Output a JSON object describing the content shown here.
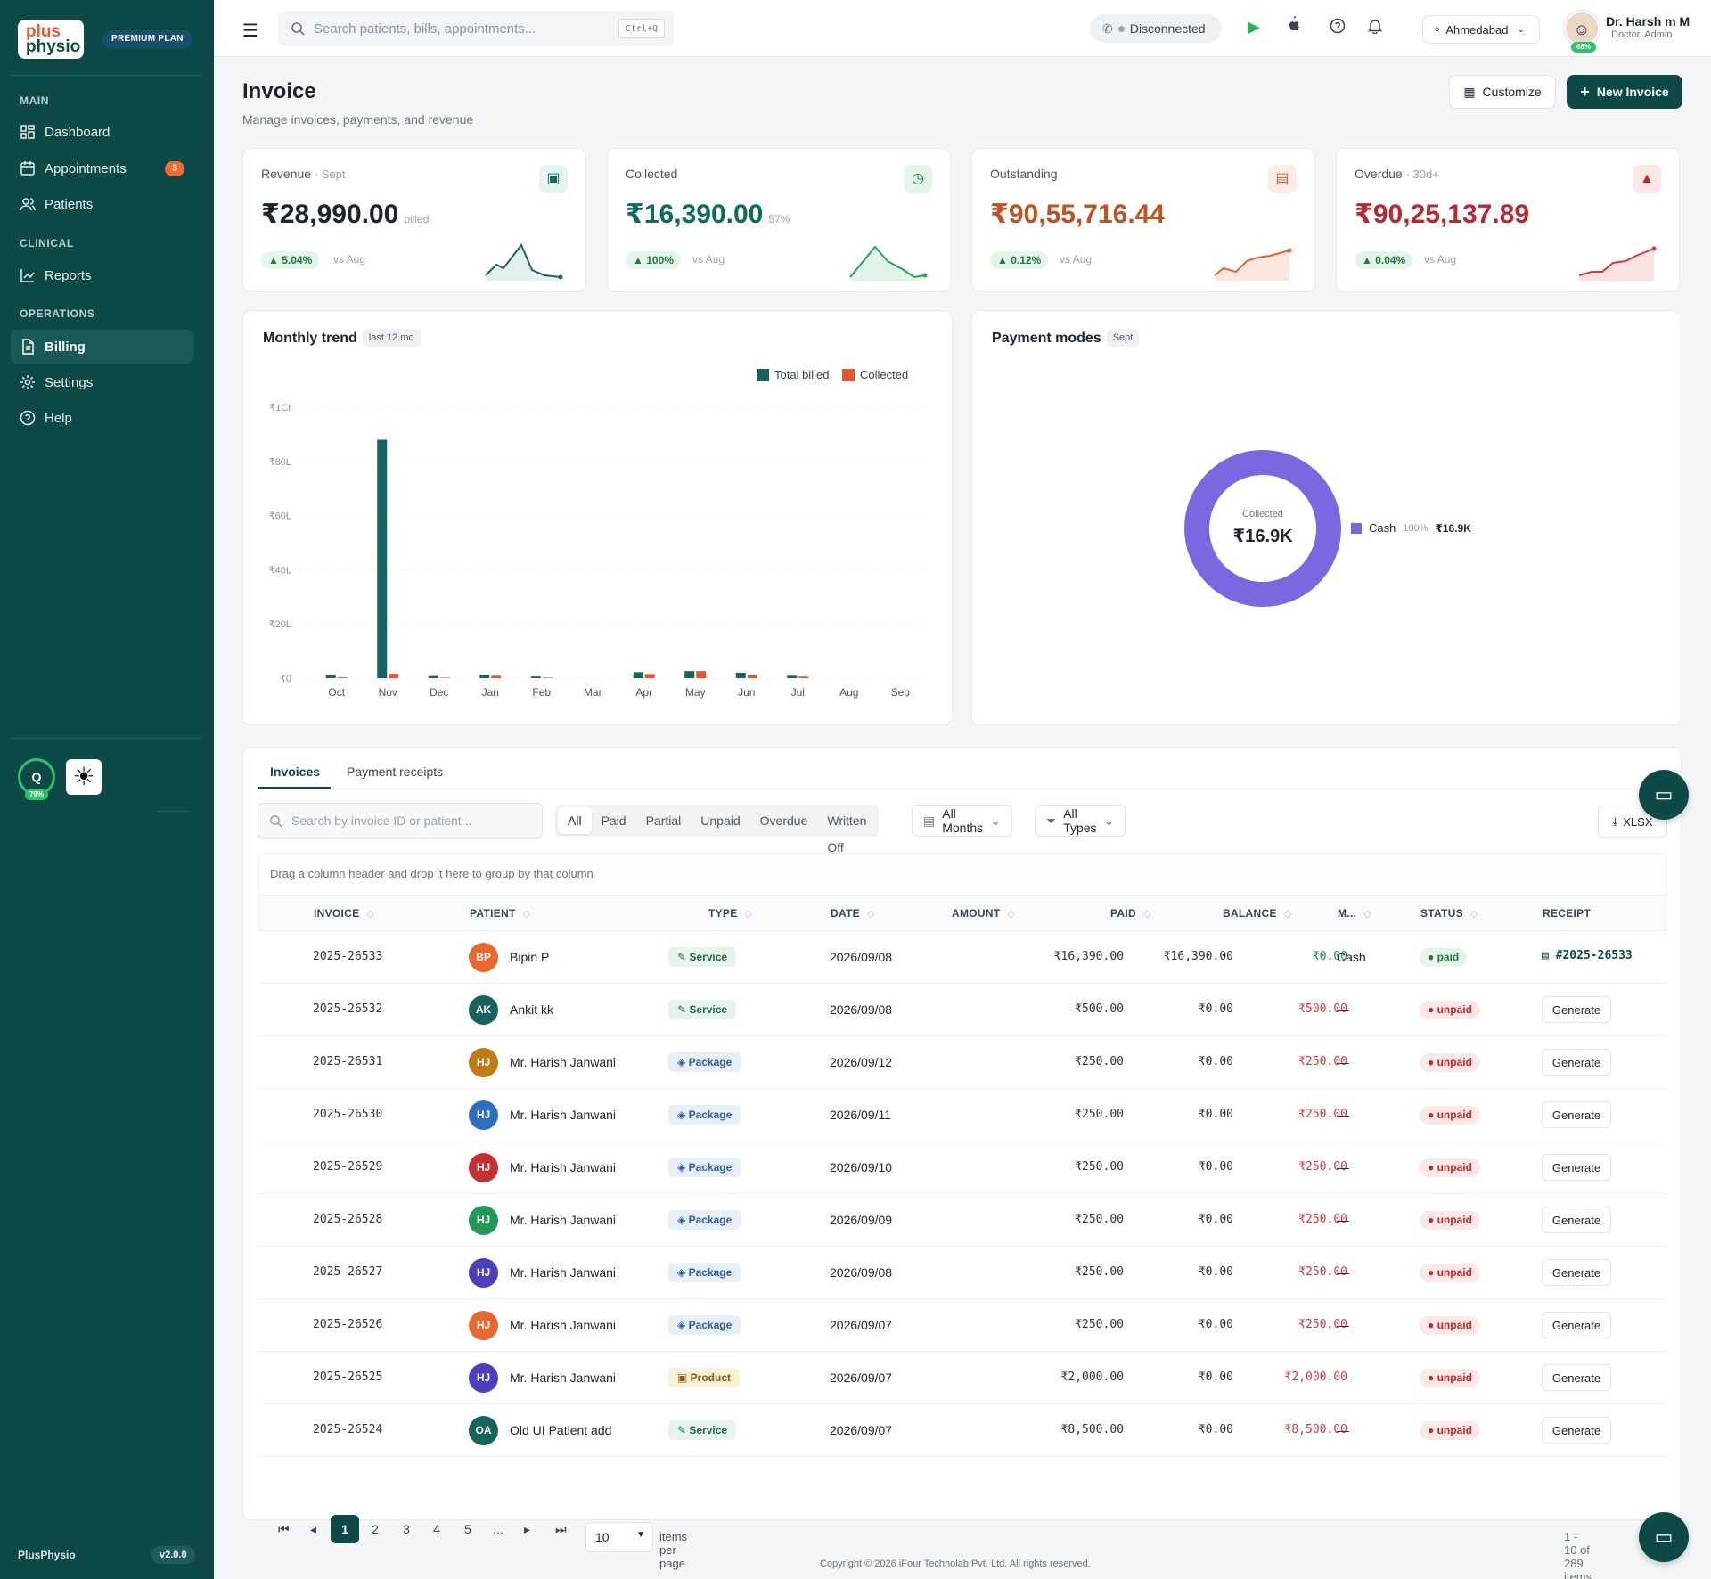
{
  "brand": {
    "logo_line1": "plus",
    "logo_line2": "physio",
    "plan": "PREMIUM PLAN",
    "name": "PlusPhysio",
    "version": "v2.0.0"
  },
  "sidebar": {
    "sections": [
      "MAIN",
      "CLINICAL",
      "OPERATIONS"
    ],
    "items": [
      {
        "label": "Dashboard",
        "icon": "grid-icon"
      },
      {
        "label": "Appointments",
        "icon": "calendar-icon",
        "badge": "3"
      },
      {
        "label": "Patients",
        "icon": "users-icon"
      },
      {
        "label": "Reports",
        "icon": "chart-line-icon"
      },
      {
        "label": "Billing",
        "icon": "file-icon",
        "active": true
      },
      {
        "label": "Settings",
        "icon": "gear-icon"
      },
      {
        "label": "Help",
        "icon": "help-icon"
      }
    ],
    "q_badge": {
      "letter": "Q",
      "percent": "79%"
    }
  },
  "topbar": {
    "search_placeholder": "Search patients, bills, appointments...",
    "shortcut": "Ctrl+Q",
    "connection": "Disconnected",
    "location": "Ahmedabad",
    "user_name": "Dr. Harsh m M",
    "user_role": "Doctor, Admin",
    "profile_percent": "68%"
  },
  "page": {
    "title": "Invoice",
    "subtitle": "Manage invoices, payments, and revenue",
    "customize": "Customize",
    "new_invoice": "New Invoice"
  },
  "kpis": [
    {
      "label": "Revenue",
      "tag": "· Sept",
      "value": "₹28,990.00",
      "suffix": "billed",
      "change": "5.04%",
      "vs": "vs Aug",
      "color": "#1b2430",
      "icon_bg": "#e7f3ef",
      "icon_color": "#0d6b5a"
    },
    {
      "label": "Collected",
      "tag": "",
      "value": "₹16,390.00",
      "suffix": "57%",
      "change": "100%",
      "vs": "vs Aug",
      "color": "#0d6b5a",
      "icon_bg": "#e3f4e8",
      "icon_color": "#1f7a40"
    },
    {
      "label": "Outstanding",
      "tag": "",
      "value": "₹90,55,716.44",
      "suffix": "",
      "change": "0.12%",
      "vs": "vs Aug",
      "color": "#c2521f",
      "icon_bg": "#fdece3",
      "icon_color": "#d25a22"
    },
    {
      "label": "Overdue",
      "tag": "· 30d+",
      "value": "₹90,25,137.89",
      "suffix": "",
      "change": "0.04%",
      "vs": "vs Aug",
      "color": "#b8282f",
      "icon_bg": "#fde6e6",
      "icon_color": "#c62828"
    }
  ],
  "trend": {
    "title": "Monthly trend",
    "tag": "last 12 mo",
    "legend": [
      "Total billed",
      "Collected"
    ],
    "colors": [
      "#17645f",
      "#e8572a"
    ]
  },
  "chart_data": {
    "type": "bar",
    "categories": [
      "Oct",
      "Nov",
      "Dec",
      "Jan",
      "Feb",
      "Mar",
      "Apr",
      "May",
      "Jun",
      "Jul",
      "Aug",
      "Sep"
    ],
    "series": [
      {
        "name": "Total billed",
        "values": [
          1.2,
          88,
          0.8,
          1.2,
          0.6,
          0,
          2.2,
          2.6,
          2.0,
          0.9,
          0,
          0
        ]
      },
      {
        "name": "Collected",
        "values": [
          0.3,
          1.6,
          0.2,
          0.9,
          0.2,
          0,
          1.5,
          2.6,
          1.2,
          0.6,
          0,
          0
        ]
      }
    ],
    "yticks": [
      "₹0",
      "₹20L",
      "₹40L",
      "₹60L",
      "₹80L",
      "₹1Cr"
    ],
    "ylim": [
      0,
      100
    ],
    "grid": true,
    "legend": "top-right"
  },
  "payment_modes": {
    "title": "Payment modes",
    "tag": "Sept",
    "center_label": "Collected",
    "center_value": "₹16.9K",
    "items": [
      {
        "name": "Cash",
        "percent": "100%",
        "amount": "₹16.9K",
        "color": "#7b68e0",
        "share": 1
      }
    ]
  },
  "table": {
    "tabs": [
      "Invoices",
      "Payment receipts"
    ],
    "search_placeholder": "Search by invoice ID or patient...",
    "filters": [
      "All",
      "Paid",
      "Partial",
      "Unpaid",
      "Overdue",
      "Written Off"
    ],
    "months": "All Months",
    "types": "All Types",
    "export": "XLSX",
    "group_hint": "Drag a column header and drop it here to group by that column",
    "columns": [
      "INVOICE",
      "PATIENT",
      "TYPE",
      "DATE",
      "AMOUNT",
      "PAID",
      "BALANCE",
      "M...",
      "STATUS",
      "RECEIPT"
    ],
    "rows": [
      {
        "invoice": "2025-26533",
        "initials": "BP",
        "av": "#e8682f",
        "patient": "Bipin P",
        "type": "Service",
        "tcls": "service",
        "date": "2026/09/08",
        "amount": "₹16,390.00",
        "paid": "₹16,390.00",
        "balance": "₹0.00",
        "bcol": "#1f8a50",
        "mode": "Cash",
        "status": "paid",
        "receipt": "#2025-26533"
      },
      {
        "invoice": "2025-26532",
        "initials": "AK",
        "av": "#17645f",
        "patient": "Ankit kk",
        "type": "Service",
        "tcls": "service",
        "date": "2026/09/08",
        "amount": "₹500.00",
        "paid": "₹0.00",
        "balance": "₹500.00",
        "bcol": "#d23a3a",
        "mode": "—",
        "status": "unpaid",
        "receipt": "Generate"
      },
      {
        "invoice": "2025-26531",
        "initials": "HJ",
        "av": "#c27a12",
        "patient": "Mr. Harish Janwani",
        "type": "Package",
        "tcls": "package",
        "date": "2026/09/12",
        "amount": "₹250.00",
        "paid": "₹0.00",
        "balance": "₹250.00",
        "bcol": "#d23a3a",
        "mode": "—",
        "status": "unpaid",
        "receipt": "Generate"
      },
      {
        "invoice": "2025-26530",
        "initials": "HJ",
        "av": "#2b6fc2",
        "patient": "Mr. Harish Janwani",
        "type": "Package",
        "tcls": "package",
        "date": "2026/09/11",
        "amount": "₹250.00",
        "paid": "₹0.00",
        "balance": "₹250.00",
        "bcol": "#d23a3a",
        "mode": "—",
        "status": "unpaid",
        "receipt": "Generate"
      },
      {
        "invoice": "2025-26529",
        "initials": "HJ",
        "av": "#c62f2f",
        "patient": "Mr. Harish Janwani",
        "type": "Package",
        "tcls": "package",
        "date": "2026/09/10",
        "amount": "₹250.00",
        "paid": "₹0.00",
        "balance": "₹250.00",
        "bcol": "#d23a3a",
        "mode": "—",
        "status": "unpaid",
        "receipt": "Generate"
      },
      {
        "invoice": "2025-26528",
        "initials": "HJ",
        "av": "#1f9a55",
        "patient": "Mr. Harish Janwani",
        "type": "Package",
        "tcls": "package",
        "date": "2026/09/09",
        "amount": "₹250.00",
        "paid": "₹0.00",
        "balance": "₹250.00",
        "bcol": "#d23a3a",
        "mode": "—",
        "status": "unpaid",
        "receipt": "Generate"
      },
      {
        "invoice": "2025-26527",
        "initials": "HJ",
        "av": "#4b3fc0",
        "patient": "Mr. Harish Janwani",
        "type": "Package",
        "tcls": "package",
        "date": "2026/09/08",
        "amount": "₹250.00",
        "paid": "₹0.00",
        "balance": "₹250.00",
        "bcol": "#d23a3a",
        "mode": "—",
        "status": "unpaid",
        "receipt": "Generate"
      },
      {
        "invoice": "2025-26526",
        "initials": "HJ",
        "av": "#e8682f",
        "patient": "Mr. Harish Janwani",
        "type": "Package",
        "tcls": "package",
        "date": "2026/09/07",
        "amount": "₹250.00",
        "paid": "₹0.00",
        "balance": "₹250.00",
        "bcol": "#d23a3a",
        "mode": "—",
        "status": "unpaid",
        "receipt": "Generate"
      },
      {
        "invoice": "2025-26525",
        "initials": "HJ",
        "av": "#4b3fc0",
        "patient": "Mr. Harish Janwani",
        "type": "Product",
        "tcls": "product",
        "date": "2026/09/07",
        "amount": "₹2,000.00",
        "paid": "₹0.00",
        "balance": "₹2,000.00",
        "bcol": "#d23a3a",
        "mode": "—",
        "status": "unpaid",
        "receipt": "Generate"
      },
      {
        "invoice": "2025-26524",
        "initials": "OA",
        "av": "#17645f",
        "patient": "Old UI Patient add",
        "type": "Service",
        "tcls": "service",
        "date": "2026/09/07",
        "amount": "₹8,500.00",
        "paid": "₹0.00",
        "balance": "₹8,500.00",
        "bcol": "#d23a3a",
        "mode": "—",
        "status": "unpaid",
        "receipt": "Generate"
      }
    ],
    "pages": [
      "1",
      "2",
      "3",
      "4",
      "5",
      "..."
    ],
    "per_page": "10",
    "per_page_label": "items per page",
    "summary": "1 - 10 of 289 items"
  },
  "footer": "Copyright © 2026 iFour Technolab Pvt. Ltd. All rights reserved."
}
